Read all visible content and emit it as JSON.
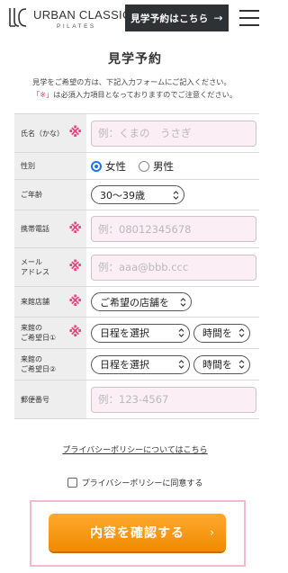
{
  "header": {
    "logo_name": "URBAN CLASSIC",
    "logo_sub": "PILATES",
    "visit_button": "見学予約はこちら",
    "visit_arrow": "→"
  },
  "page_title": "見学予約",
  "intro": {
    "line1": "見学をご希望の方は、下記入力フォームにご記入ください。",
    "line2_req": "「※」",
    "line2_rest": "は必須入力項目となっておりますのでご注意ください。"
  },
  "form": {
    "name_label": "氏名（かな）",
    "name_placeholder": "例：くまの　うさぎ",
    "gender_label": "性別",
    "gender_female": "女性",
    "gender_male": "男性",
    "age_label": "ご年齢",
    "age_value": "30〜39歳",
    "phone_label": "携帯電話",
    "phone_placeholder": "例：08012345678",
    "email_label_1": "メール",
    "email_label_2": "アドレス",
    "email_placeholder": "例：aaa@bbb.ccc",
    "store_label": "来館店舗",
    "store_value": "ご希望の店舗を",
    "date1_label_1": "来館の",
    "date1_label_2": "ご希望日①",
    "date2_label_1": "来館の",
    "date2_label_2": "ご希望日②",
    "date_value": "日程を選択",
    "time_value": "時間を",
    "zip_label": "郵便番号",
    "zip_placeholder": "例：123-4567",
    "required_mark": "※"
  },
  "privacy_link": "プライバシーポリシーについてはこちら",
  "agree_label": "プライバシーポリシーに同意する",
  "submit": {
    "label": "内容を確認する",
    "arrow": "›"
  }
}
